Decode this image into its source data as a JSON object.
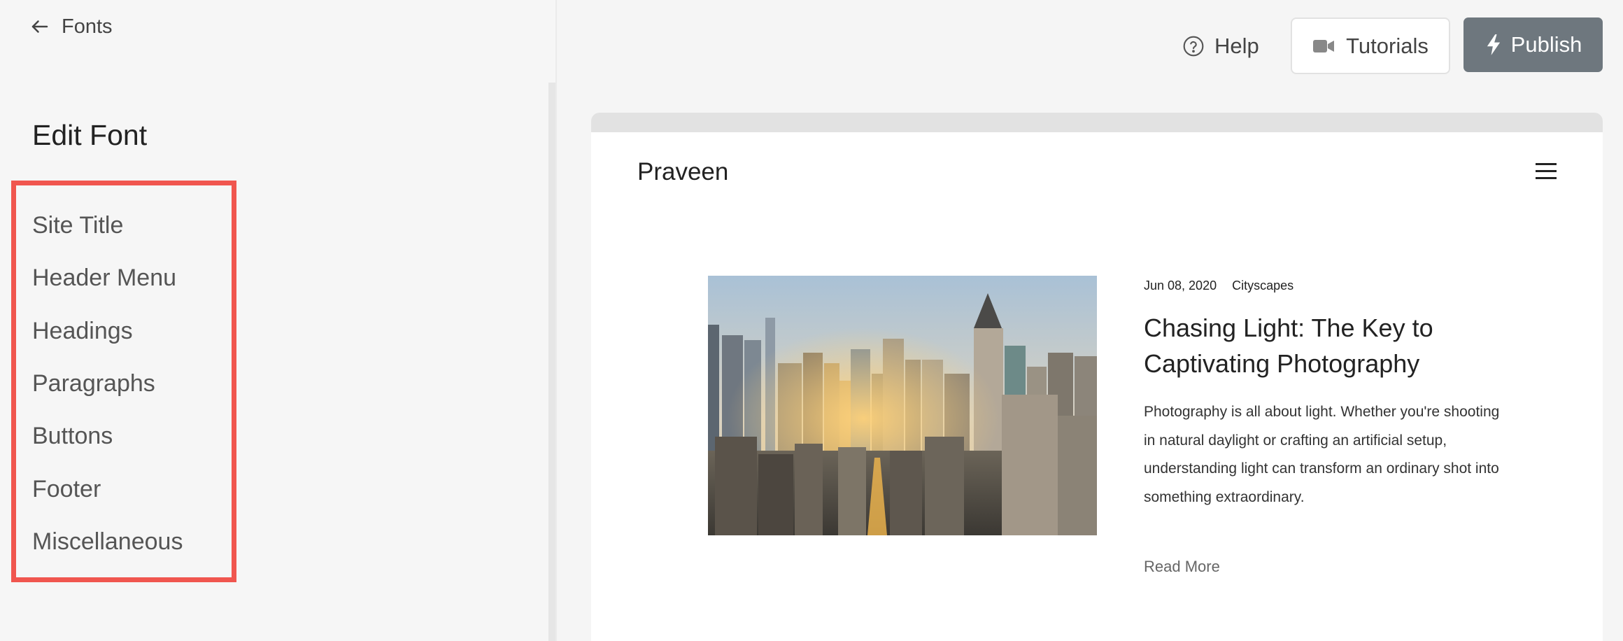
{
  "left_panel": {
    "back_label": "Fonts",
    "title": "Edit Font",
    "items": [
      {
        "label": "Site Title"
      },
      {
        "label": "Header Menu"
      },
      {
        "label": "Headings"
      },
      {
        "label": "Paragraphs"
      },
      {
        "label": "Buttons"
      },
      {
        "label": "Footer"
      },
      {
        "label": "Miscellaneous"
      }
    ],
    "highlight_color": "#f0564f"
  },
  "toolbar": {
    "help_label": "Help",
    "tutorials_label": "Tutorials",
    "publish_label": "Publish",
    "publish_color": "#6e777e",
    "icons": [
      "question-circle-icon",
      "video-camera-icon",
      "lightning-bolt-icon"
    ]
  },
  "preview": {
    "site_name": "Praveen",
    "menu_icon": "hamburger-menu-icon",
    "post": {
      "date": "Jun 08, 2020",
      "category": "Cityscapes",
      "title": "Chasing Light: The Key to Captivating Photography",
      "excerpt": "Photography is all about light. Whether you're shooting in natural daylight or crafting an artificial setup, understanding light can transform an ordinary shot into something extraordinary.",
      "read_more": "Read More",
      "image_subject": "city skyline at sunset"
    }
  }
}
